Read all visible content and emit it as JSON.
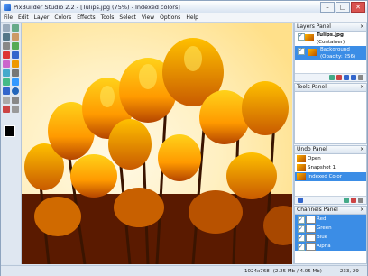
{
  "window": {
    "title": "PixBuilder Studio 2.2 - [Tulips.jpg (75%) - Indexed colors]",
    "buttons": {
      "minimize": "–",
      "maximize": "□",
      "close": "✕"
    }
  },
  "menu": [
    "File",
    "Edit",
    "Layer",
    "Colors",
    "Effects",
    "Tools",
    "Select",
    "View",
    "Options",
    "Help"
  ],
  "layers_panel": {
    "title": "Layers Panel",
    "items": [
      {
        "name": "Tulips.jpg",
        "sub": "(Container)"
      },
      {
        "name": "Background",
        "sub": "(Opacity: 256)"
      }
    ]
  },
  "tools_panel": {
    "title": "Tools Panel"
  },
  "undo_panel": {
    "title": "Undo Panel",
    "items": [
      "Open",
      "Snapshot 1",
      "Indexed Color"
    ]
  },
  "channels_panel": {
    "title": "Channels Panel",
    "items": [
      "Red",
      "Green",
      "Blue",
      "Alpha"
    ]
  },
  "status": {
    "dimensions": "1024x768",
    "memory": "(2.25 Mb / 4.05 Mb)",
    "coords": "233, 29"
  }
}
